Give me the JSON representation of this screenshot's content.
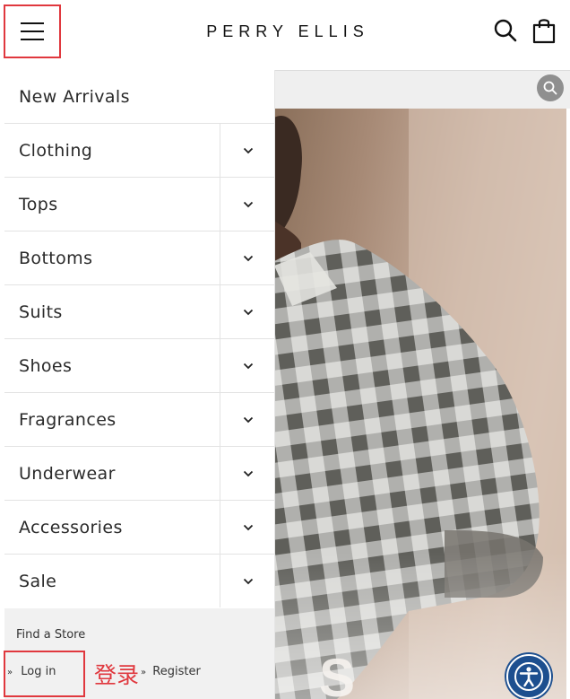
{
  "header": {
    "brand": "PERRY ELLIS",
    "menu_icon": "hamburger-icon",
    "search_icon": "search-icon",
    "cart_icon": "shopping-bag-icon"
  },
  "drawer": {
    "items": [
      {
        "label": "New Arrivals",
        "expandable": false
      },
      {
        "label": "Clothing",
        "expandable": true
      },
      {
        "label": "Tops",
        "expandable": true
      },
      {
        "label": "Bottoms",
        "expandable": true
      },
      {
        "label": "Suits",
        "expandable": true
      },
      {
        "label": "Shoes",
        "expandable": true
      },
      {
        "label": "Fragrances",
        "expandable": true
      },
      {
        "label": "Underwear",
        "expandable": true
      },
      {
        "label": "Accessories",
        "expandable": true
      },
      {
        "label": "Sale",
        "expandable": true
      }
    ],
    "find_store": "Find a Store",
    "login": "Log in",
    "login_annotation": "登录",
    "register": "Register",
    "link_prefix": "»"
  },
  "colors": {
    "highlight": "#e0383e",
    "accessibility": "#1d4f8f"
  },
  "accessibility_icon": "accessibility-icon"
}
